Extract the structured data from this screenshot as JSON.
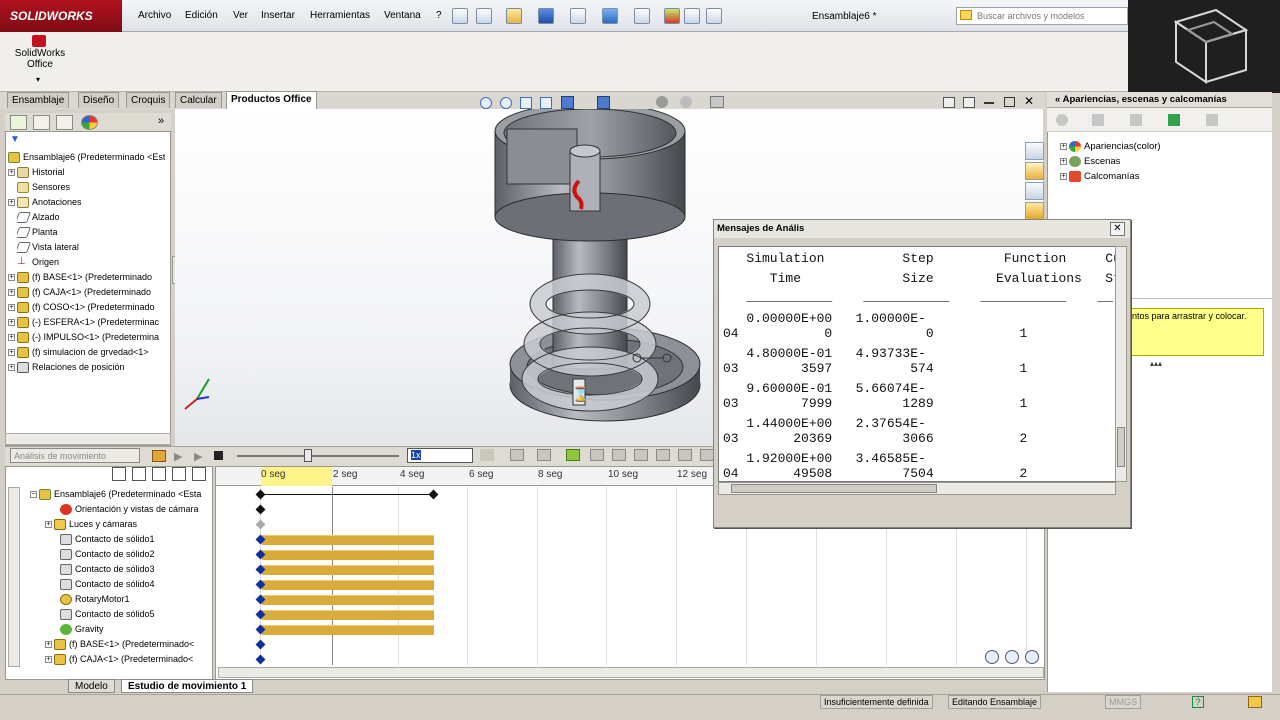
{
  "app": {
    "logo_text": "SOLIDWORKS",
    "document_title": "Ensamblaje6 *"
  },
  "menu": [
    "Archivo",
    "Edición",
    "Ver",
    "Insertar",
    "Herramientas",
    "Ventana",
    "?"
  ],
  "search": {
    "placeholder": "Buscar archivos y modelos"
  },
  "ribbon": {
    "office_button_label": "SolidWorks Office"
  },
  "command_tabs": [
    "Ensamblaje",
    "Diseño",
    "Croquis",
    "Calcular",
    "Productos Office"
  ],
  "active_command_tab": "Productos Office",
  "feature_tree": {
    "root": "Ensamblaje6  (Predeterminado <Est",
    "items": [
      "Historial",
      "Sensores",
      "Anotaciones",
      "Alzado",
      "Planta",
      "Vista lateral",
      "Origen",
      "(f) BASE<1> (Predeterminado",
      "(f) CAJA<1> (Predeterminado",
      "(f) COSO<1> (Predeterminado",
      "(-) ESFERA<1> (Predeterminac",
      "(-) IMPULSO<1> (Predetermina",
      "(f) simulacion de grvedad<1>",
      "Relaciones de posición"
    ]
  },
  "motion_toolbar": {
    "study_type": "Análisis de movimiento",
    "speed_field": "1x"
  },
  "motion_tree": {
    "root": "Ensamblaje6  (Predeterminado <Esta",
    "items": [
      "Orientación y vistas de cámara",
      "Luces y cámaras",
      "Contacto de sólido1",
      "Contacto de sólido2",
      "Contacto de sólido3",
      "Contacto de sólido4",
      "RotaryMotor1",
      "Contacto de sólido5",
      "Gravity",
      "(f) BASE<1> (Predeterminado<",
      "(f) CAJA<1> (Predeterminado<"
    ]
  },
  "timeline": {
    "ruler_labels": [
      "0 seg",
      "2 seg",
      "4 seg",
      "6 seg",
      "8 seg",
      "10 seg",
      "12 seg"
    ]
  },
  "bottom_tabs": [
    "Modelo",
    "Estudio de movimiento 1"
  ],
  "active_bottom_tab": "Estudio de movimiento 1",
  "status": {
    "definition": "Insuficientemente definida",
    "mode": "Editando Ensamblaje",
    "units": "MMGS"
  },
  "task_pane": {
    "title": "Apariencias, escenas y calcomanías",
    "items": [
      "Apariencias(color)",
      "Escenas",
      "Calcomanías"
    ],
    "tooltip": "ntos para arrastrar y colocar."
  },
  "dialog": {
    "title": "Mensajes de Anális",
    "header_line1": "   Simulation          Step         Function     Cu",
    "header_line2": "      Time             Size        Evaluations   St",
    "header_line3": "   ___________    ___________    ___________    __",
    "rows": [
      [
        "   0.00000E+00   1.00000E-",
        "04           0            0           1"
      ],
      [
        "   4.80000E-01   4.93733E-",
        "03        3597          574           1"
      ],
      [
        "   9.60000E-01   5.66074E-",
        "03        7999         1289           1"
      ],
      [
        "   1.44000E+00   2.37654E-",
        "03       20369         3066           2"
      ],
      [
        "   1.92000E+00   3.46585E-",
        "04       49508         7504           2"
      ]
    ]
  }
}
